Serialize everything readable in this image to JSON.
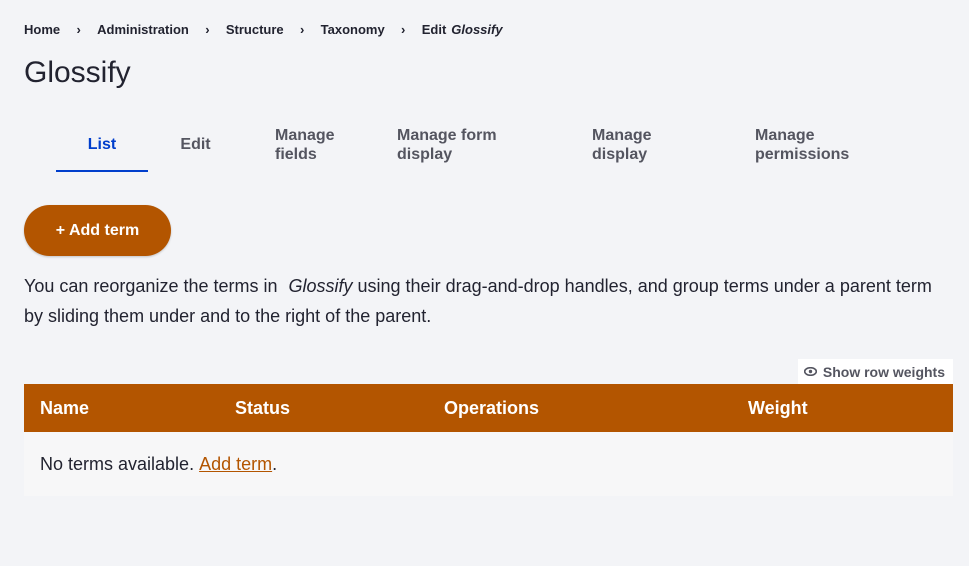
{
  "breadcrumb": {
    "items": [
      "Home",
      "Administration",
      "Structure",
      "Taxonomy"
    ],
    "separator": "›",
    "current_prefix": "Edit",
    "current_name": "Glossify"
  },
  "page_title": "Glossify",
  "tabs": [
    {
      "label": "List",
      "active": true
    },
    {
      "label": "Edit",
      "active": false
    },
    {
      "label": "Manage fields",
      "active": false
    },
    {
      "label": "Manage form display",
      "active": false
    },
    {
      "label": "Manage display",
      "active": false
    },
    {
      "label": "Manage permissions",
      "active": false
    }
  ],
  "add_term_button": "+ Add term",
  "description": {
    "before": "You can reorganize the terms in ",
    "vocab": "Glossify",
    "after": " using their drag-and-drop handles, and group terms under a parent term by sliding them under and to the right of the parent."
  },
  "row_weights_label": "Show row weights",
  "table": {
    "columns": [
      "Name",
      "Status",
      "Operations",
      "Weight"
    ],
    "empty_text": "No terms available. ",
    "empty_link": "Add term",
    "empty_suffix": "."
  },
  "colors": {
    "accent": "#003ecc",
    "primary_button": "#b35500",
    "table_header": "#b35500",
    "background": "#f3f4f7"
  }
}
